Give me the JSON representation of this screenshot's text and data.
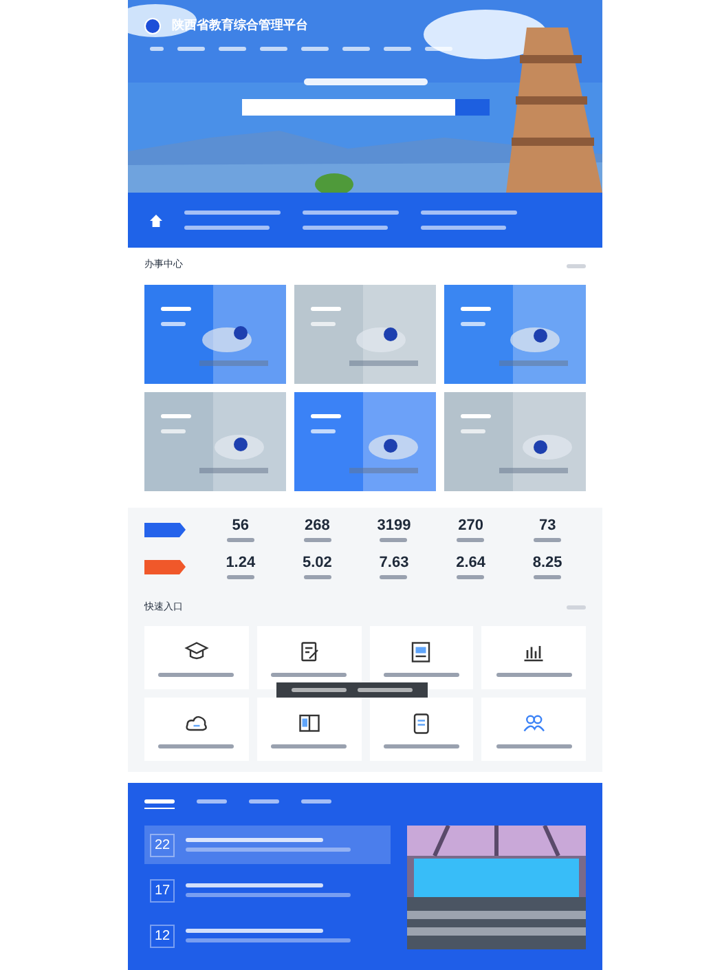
{
  "header": {
    "title": "陕西省教育综合管理平台"
  },
  "service_center": {
    "title": "办事中心",
    "cards": [
      {
        "color": "#2f7bf0"
      },
      {
        "color": "#b9c6cf"
      },
      {
        "color": "#3a86f2"
      },
      {
        "color": "#aebfcc"
      },
      {
        "color": "#3b82f6"
      },
      {
        "color": "#b4c2cc"
      }
    ]
  },
  "stats": [
    {
      "color": "#2563eb",
      "values": [
        "56",
        "268",
        "3199",
        "270",
        "73"
      ]
    },
    {
      "color": "#f0582a",
      "values": [
        "1.24",
        "5.02",
        "7.63",
        "2.64",
        "8.25"
      ]
    }
  ],
  "quick_entry": {
    "title": "快速入口"
  },
  "news": {
    "tabs": [
      {
        "selected": true
      },
      {
        "selected": false
      },
      {
        "selected": false
      },
      {
        "selected": false
      }
    ],
    "items": [
      {
        "day": "22",
        "selected": true
      },
      {
        "day": "17",
        "selected": false
      },
      {
        "day": "12",
        "selected": false
      }
    ]
  }
}
